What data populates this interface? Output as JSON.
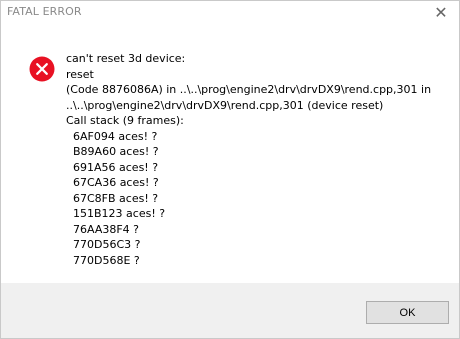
{
  "window": {
    "title": "FATAL ERROR",
    "close_glyph": "✕"
  },
  "icon": {
    "name": "error-icon",
    "color": "#e81123"
  },
  "message": {
    "lines": [
      "can't reset 3d device:",
      "reset",
      "(Code 8876086A) in ..\\..\\prog\\engine2\\drv\\drvDX9\\rend.cpp,301 in",
      "..\\..\\prog\\engine2\\drv\\drvDX9\\rend.cpp,301 (device reset)",
      "Call stack (9 frames):"
    ],
    "frames": [
      "6AF094   aces! ?",
      "B89A60   aces! ?",
      "691A56   aces! ?",
      "67CA36   aces! ?",
      "67C8FB   aces! ?",
      "151B123   aces! ?",
      "76AA38F4 ?",
      "770D56C3 ?",
      "770D568E ?"
    ]
  },
  "footer": {
    "ok_label": "OK"
  }
}
